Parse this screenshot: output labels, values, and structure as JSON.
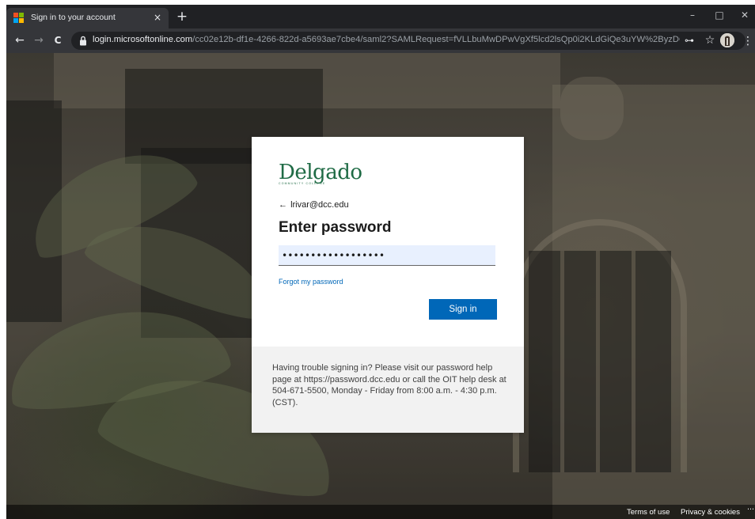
{
  "browser": {
    "tab": {
      "title": "Sign in to your account",
      "close": "×"
    },
    "new_tab": "+",
    "window_controls": {
      "minimize": "–",
      "maximize": "□",
      "close": "✕"
    },
    "nav": {
      "back": "←",
      "forward": "→",
      "reload": "C"
    },
    "address": {
      "host": "login.microsoftonline.com",
      "path": "/cc02e12b-df1e-4266-822d-a5693ae7cbe4/saml2?SAMLRequest=fVLLbuMwDPwVgXf5lcd2lsQp0i2KLdGiQe3uYW%2ByzDQ..."
    },
    "icons": {
      "key": "⊶",
      "star": "☆",
      "menu": "⋮"
    }
  },
  "signin": {
    "logo": {
      "name": "Delgado",
      "sub": "COMMUNITY COLLEGE"
    },
    "back_arrow": "←",
    "account": "lrivar@dcc.edu",
    "heading": "Enter password",
    "password_value": "••••••••••••••••••",
    "forgot_link": "Forgot my password",
    "signin_button": "Sign in",
    "help_text": "Having trouble signing in? Please visit our password help page at https://password.dcc.edu or call the OIT help desk at 504-671-5500, Monday - Friday from 8:00 a.m. - 4:30 p.m. (CST)."
  },
  "footer": {
    "terms": "Terms of use",
    "privacy": "Privacy & cookies",
    "more": "···"
  },
  "colors": {
    "brand_green": "#1f6b45",
    "button_blue": "#0067b8",
    "link_blue": "#0067b8"
  }
}
